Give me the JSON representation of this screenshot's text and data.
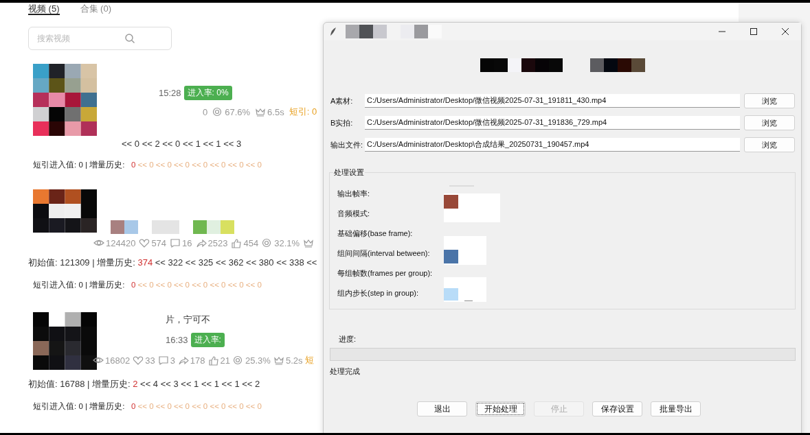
{
  "tabs": [
    {
      "label": "视频 (5)",
      "selected": true
    },
    {
      "label": "合集 (0)",
      "selected": false
    }
  ],
  "search": {
    "placeholder": "搜索视频"
  },
  "videos": [
    {
      "time": "15:28",
      "badge": "进入率: 0%",
      "stats": [
        {
          "kind": "plain",
          "value": "0"
        },
        {
          "kind": "rate",
          "value": "67.6%"
        },
        {
          "kind": "duration",
          "value": "6.5s"
        },
        {
          "kind": "short",
          "value": "短引: 0"
        }
      ],
      "history": {
        "rest": "<< 0 << 2 << 0 << 1 << 1 << 3"
      },
      "short_history": {
        "label": "短引进入值: 0 | 增量历史:",
        "first": "0",
        "rest": "<< 0 << 0 << 0 << 0 << 0 << 0 << 0"
      }
    },
    {
      "stats": [
        {
          "kind": "views",
          "value": "124420"
        },
        {
          "kind": "likes",
          "value": "574"
        },
        {
          "kind": "comments",
          "value": "16"
        },
        {
          "kind": "shares",
          "value": "2523"
        },
        {
          "kind": "thumbs",
          "value": "454"
        },
        {
          "kind": "rate",
          "value": "32.1%"
        },
        {
          "kind": "duration"
        }
      ],
      "history": {
        "prefix": "初始值: 121309 | 增量历史:",
        "first": "374",
        "rest": "<< 322 << 325 << 362 << 380 << 338 <<"
      },
      "short_history": {
        "label": "短引进入值: 0 | 增量历史:",
        "first": "0",
        "rest": "<< 0 << 0 << 0 << 0 << 0 << 0 << 0"
      }
    },
    {
      "title": "片，宁可不",
      "time": "16:33",
      "badge": "进入率:",
      "stats": [
        {
          "kind": "views",
          "value": "16802"
        },
        {
          "kind": "likes",
          "value": "33"
        },
        {
          "kind": "comments",
          "value": "3"
        },
        {
          "kind": "shares",
          "value": "178"
        },
        {
          "kind": "thumbs",
          "value": "21"
        },
        {
          "kind": "rate",
          "value": "25.3%"
        },
        {
          "kind": "duration",
          "value": "5.2s"
        },
        {
          "kind": "short",
          "value": "短"
        }
      ],
      "history": {
        "prefix": "初始值: 16788 | 增量历史:",
        "first": "2",
        "rest": "<< 4 << 3 << 1 << 1 << 1 << 2"
      },
      "short_history": {
        "label": "短引进入值: 0 | 增量历史:",
        "first": "0",
        "rest": "<< 0 << 0 << 0 << 0 << 0 << 0 << 0"
      }
    }
  ],
  "dialog": {
    "files": [
      {
        "label": "A素材:",
        "value": "C:/Users/Administrator/Desktop/微信视频2025-07-31_191811_430.mp4",
        "button": "浏览"
      },
      {
        "label": "B实拍:",
        "value": "C:/Users/Administrator/Desktop/微信视频2025-07-31_191836_729.mp4",
        "button": "浏览"
      },
      {
        "label": "输出文件:",
        "value": "C:/Users/Administrator/Desktop\\合成结果_20250731_190457.mp4",
        "button": "浏览"
      }
    ],
    "settings": {
      "title": "处理设置",
      "labels": [
        "输出帧率:",
        "音频模式:",
        "基础偏移(base frame):",
        "组间间隔(interval between):",
        "每组帧数(frames per group):",
        "组内步长(step in group):"
      ]
    },
    "progress": {
      "label": "进度:",
      "level": 0
    },
    "status": "处理完成",
    "buttons": [
      {
        "label": "退出",
        "disabled": false,
        "focused": false
      },
      {
        "label": "开始处理",
        "disabled": false,
        "focused": true
      },
      {
        "label": "停止",
        "disabled": true,
        "focused": false
      },
      {
        "label": "保存设置",
        "disabled": false,
        "focused": false
      },
      {
        "label": "批量导出",
        "disabled": false,
        "focused": false
      }
    ]
  }
}
